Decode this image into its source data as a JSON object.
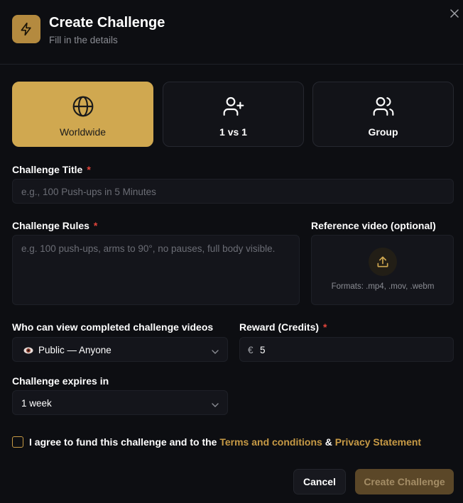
{
  "dialog": {
    "title": "Create Challenge",
    "subtitle": "Fill in the details",
    "header_icon": "lightning-icon",
    "close_icon": "close-icon"
  },
  "challenge_types": [
    {
      "label": "Worldwide",
      "icon": "globe-icon",
      "selected": true
    },
    {
      "label": "1 vs 1",
      "icon": "user-plus-icon",
      "selected": false
    },
    {
      "label": "Group",
      "icon": "users-icon",
      "selected": false
    }
  ],
  "form": {
    "title_label": "Challenge Title",
    "title_placeholder": "e.g., 100 Push-ups in 5 Minutes",
    "rules_label": "Challenge Rules",
    "rules_placeholder": "e.g. 100 push-ups, arms to 90°, no pauses, full body visible.",
    "video_label": "Reference video (optional)",
    "video_formats": "Formats: .mp4, .mov, .webm",
    "visibility_label": "Who can view completed challenge videos",
    "visibility_icon": "eye-icon",
    "visibility_value": "Public — Anyone",
    "reward_label": "Reward (Credits)",
    "currency_symbol": "€",
    "reward_value": "5",
    "expires_label": "Challenge expires in",
    "expires_value": "1 week",
    "required_mark": "*"
  },
  "agreement": {
    "text": "I agree to fund this challenge and to the",
    "terms_link": "Terms and conditions",
    "amp": "&",
    "privacy_link": "Privacy Statement",
    "checked": false
  },
  "buttons": {
    "cancel": "Cancel",
    "create": "Create Challenge"
  },
  "colors": {
    "accent": "#d0a850",
    "link": "#c79a45",
    "background": "#0d0e12",
    "required": "#e0443a"
  }
}
